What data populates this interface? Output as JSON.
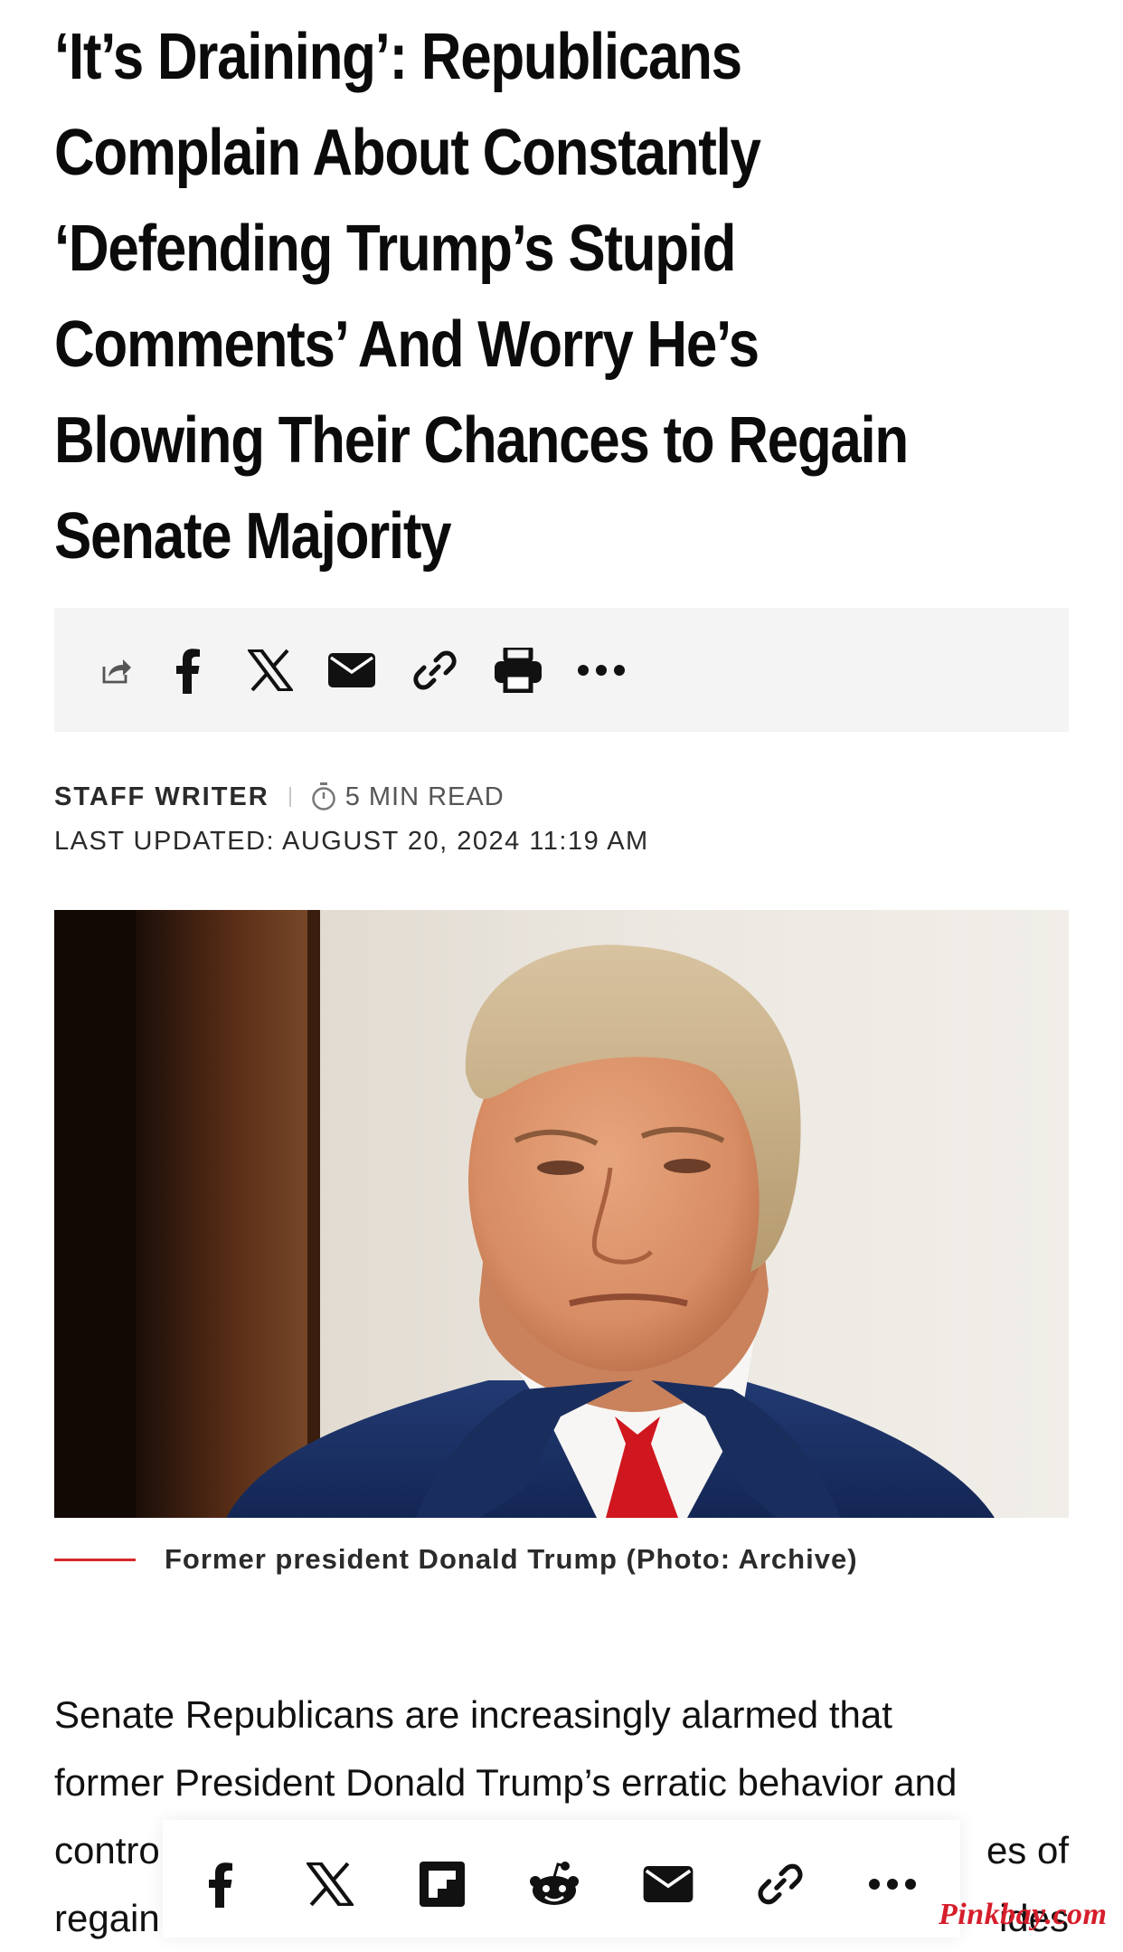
{
  "article": {
    "headline": "‘It’s Draining’: Republicans Complain About Constantly ‘Defending Trump’s Stupid Comments’ And Worry He’s Blowing Their Chances to Regain Senate Majority",
    "author": "STAFF WRITER",
    "read_time": "5 MIN READ",
    "updated": "LAST UPDATED: AUGUST 20, 2024 11:19 AM",
    "image_caption": "Former president Donald Trump (Photo: Archive)",
    "body_line_1": "Senate Republicans are increasingly alarmed that",
    "body_line_2": "former President Donald Trump’s erratic behavior and",
    "body_line_3_left": "contro",
    "body_line_3_right": "es of",
    "body_line_4_left": "regain",
    "body_line_4_right": "ides"
  },
  "share_bar": {
    "icons": [
      "share-icon",
      "facebook-icon",
      "x-icon",
      "email-icon",
      "link-icon",
      "print-icon",
      "more-icon"
    ]
  },
  "floating_share_bar": {
    "icons": [
      "facebook-icon",
      "x-icon",
      "flipboard-icon",
      "reddit-icon",
      "email-icon",
      "link-icon",
      "more-icon"
    ]
  },
  "watermark": "Pinkbay.com",
  "colors": {
    "accent": "#d42a2a",
    "text": "#111111",
    "sharebar_bg": "#f4f4f4",
    "watermark": "#d61e2b"
  }
}
